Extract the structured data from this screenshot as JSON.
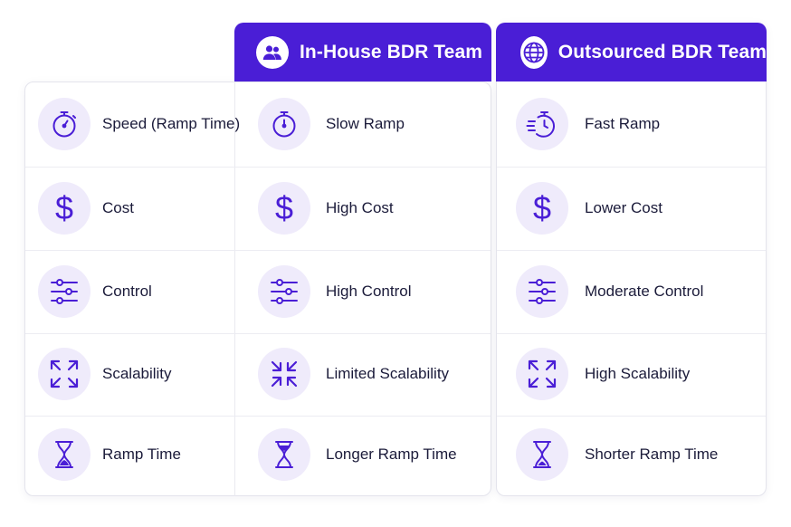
{
  "columns": {
    "inhouse": {
      "title": "In-House BDR Team",
      "icon": "users-icon"
    },
    "outsourced": {
      "title": "Outsourced BDR Team",
      "icon": "globe-icon"
    }
  },
  "rows": [
    {
      "criterion": "Speed (Ramp Time)",
      "criterion_icon": "stopwatch-icon",
      "inhouse": "Slow Ramp",
      "inhouse_icon": "stopwatch-icon",
      "outsourced": "Fast Ramp",
      "outsourced_icon": "fast-stopwatch-icon"
    },
    {
      "criterion": "Cost",
      "criterion_icon": "dollar-icon",
      "inhouse": "High Cost",
      "inhouse_icon": "dollar-icon",
      "outsourced": "Lower Cost",
      "outsourced_icon": "dollar-icon"
    },
    {
      "criterion": "Control",
      "criterion_icon": "sliders-icon",
      "inhouse": "High Control",
      "inhouse_icon": "sliders-icon",
      "outsourced": "Moderate Control",
      "outsourced_icon": "sliders-icon"
    },
    {
      "criterion": "Scalability",
      "criterion_icon": "expand-icon",
      "inhouse": "Limited Scalability",
      "inhouse_icon": "collapse-icon",
      "outsourced": "High Scalability",
      "outsourced_icon": "expand-icon"
    },
    {
      "criterion": "Ramp Time",
      "criterion_icon": "hourglass-icon",
      "inhouse": "Longer Ramp Time",
      "inhouse_icon": "hourglass-icon",
      "outsourced": "Shorter Ramp Time",
      "outsourced_icon": "hourglass-icon"
    }
  ],
  "colors": {
    "accent": "#4a1ed6",
    "icon_bg": "#efebfb",
    "text": "#1b1b3a"
  }
}
